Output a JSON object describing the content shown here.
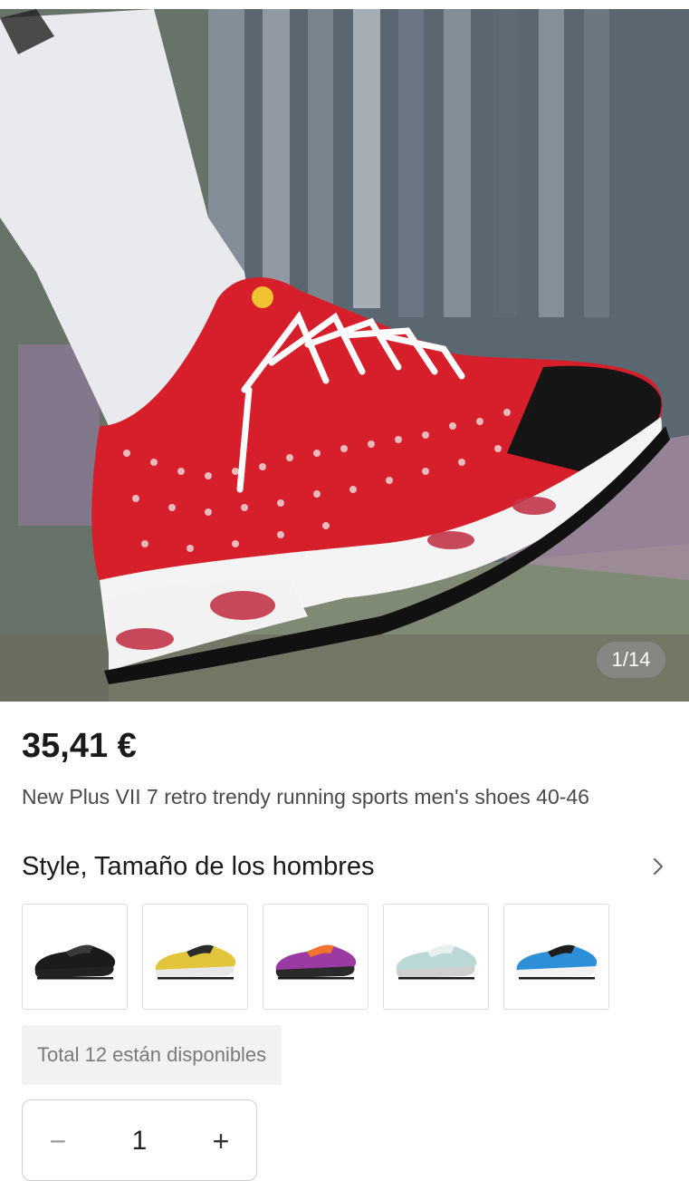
{
  "gallery": {
    "counter": "1/14",
    "image_alt": "red-and-white-running-shoe-photo"
  },
  "product": {
    "price": "35,41 €",
    "title": "New Plus VII 7 retro trendy running sports men's shoes 40-46"
  },
  "variants": {
    "section_title": "Style, Tamaño de los hombres",
    "options": [
      {
        "name": "black",
        "upper": "#1b1b1b",
        "accent": "#3a3a3a",
        "sole": "#222222"
      },
      {
        "name": "yellow",
        "upper": "#e3c53b",
        "accent": "#2b2b2b",
        "sole": "#e8e8e8"
      },
      {
        "name": "orange-purple",
        "upper": "#9b3aa3",
        "accent": "#f0742d",
        "sole": "#2a2a2a"
      },
      {
        "name": "mint-white",
        "upper": "#b9d8d6",
        "accent": "#e9efef",
        "sole": "#cfcfcf"
      },
      {
        "name": "blue-black",
        "upper": "#2d8fd8",
        "accent": "#1d1d1d",
        "sole": "#f2f2f2"
      }
    ]
  },
  "stock": {
    "text": "Total 12 están disponibles"
  },
  "quantity": {
    "minus": "−",
    "value": "1",
    "plus": "+"
  },
  "colors": {
    "price": "#1a1a1a",
    "subtle_text": "#7a7a7a"
  }
}
